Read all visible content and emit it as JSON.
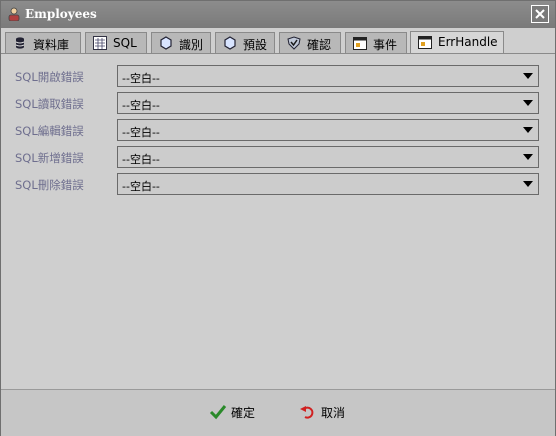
{
  "window": {
    "title": "Employees"
  },
  "tabs": [
    {
      "label": "資料庫",
      "icon": "database-icon"
    },
    {
      "label": "SQL",
      "icon": "sql-icon"
    },
    {
      "label": "識別",
      "icon": "hexagon-icon"
    },
    {
      "label": "預設",
      "icon": "hexagon-icon"
    },
    {
      "label": "確認",
      "icon": "shield-check-icon"
    },
    {
      "label": "事件",
      "icon": "event-icon"
    },
    {
      "label": "ErrHandle",
      "icon": "event-icon"
    }
  ],
  "active_tab": "ErrHandle",
  "errors": [
    {
      "label": "SQL開啟錯誤",
      "value": "--空白--"
    },
    {
      "label": "SQL讀取錯誤",
      "value": "--空白--"
    },
    {
      "label": "SQL編輯錯誤",
      "value": "--空白--"
    },
    {
      "label": "SQL新增錯誤",
      "value": "--空白--"
    },
    {
      "label": "SQL刪除錯誤",
      "value": "--空白--"
    }
  ],
  "footer": {
    "ok_label": "確定",
    "cancel_label": "取消"
  },
  "colors": {
    "label_text": "#6e6e8e",
    "ok_check": "#2a8a2a",
    "cancel_arrow": "#d02020"
  }
}
